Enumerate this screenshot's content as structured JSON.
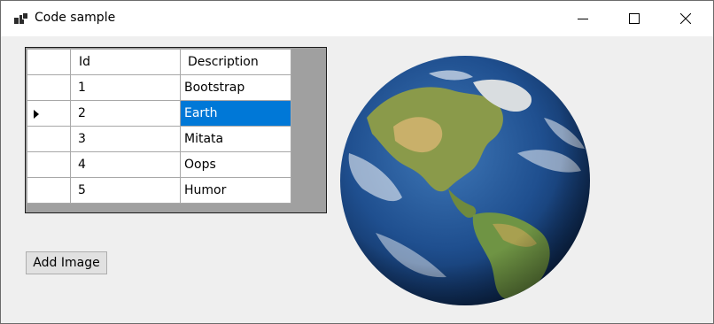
{
  "window": {
    "title": "Code sample"
  },
  "grid": {
    "columns": [
      "Id",
      "Description"
    ],
    "rows": [
      {
        "id": "1",
        "description": "Bootstrap"
      },
      {
        "id": "2",
        "description": "Earth",
        "selected": true
      },
      {
        "id": "3",
        "description": "Mitata"
      },
      {
        "id": "4",
        "description": "Oops"
      },
      {
        "id": "5",
        "description": "Humor"
      }
    ]
  },
  "buttons": {
    "add_image": "Add Image"
  },
  "icons": {
    "app": "app-window-icon",
    "minimize": "minimize-icon",
    "maximize": "maximize-icon",
    "close": "close-icon",
    "row_pointer": "current-row-arrow-icon"
  },
  "colors": {
    "selection": "#0078d7",
    "grid_background": "#a0a0a0",
    "window_background": "#efefef"
  }
}
